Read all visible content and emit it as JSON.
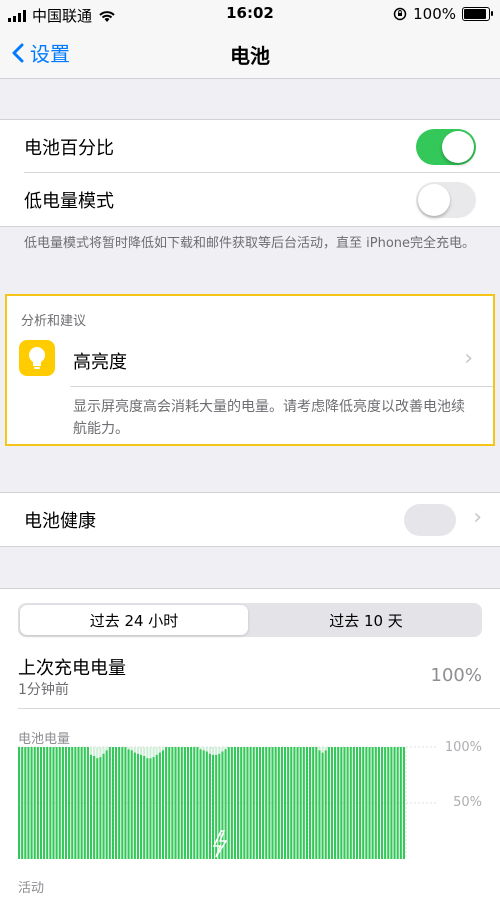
{
  "status_bar": {
    "carrier": "中国联通",
    "time": "16:02",
    "battery_pct": "100%",
    "battery_level": 1.0
  },
  "nav": {
    "back_label": "设置",
    "title": "电池"
  },
  "settings": {
    "battery_percentage": {
      "label": "电池百分比",
      "on": true
    },
    "low_power_mode": {
      "label": "低电量模式",
      "on": false
    },
    "low_power_footer": "低电量模式将暂时降低如下载和邮件获取等后台活动，直至 iPhone完全充电。"
  },
  "insights": {
    "header": "分析和建议",
    "item_title": "高亮度",
    "item_desc": "显示屏亮度高会消耗大量的电量。请考虑降低亮度以改善电池续航能力。",
    "icon": "lightbulb-icon"
  },
  "battery_health": {
    "label": "电池健康"
  },
  "usage": {
    "tabs": [
      "过去 24 小时",
      "过去 10 天"
    ],
    "selected_tab": 0,
    "last_charge_label": "上次充电电量",
    "last_charge_time": "1分钟前",
    "last_charge_value": "100%",
    "battery_level_label": "电池电量",
    "axis_labels": [
      "100%",
      "50%"
    ],
    "activity_label": "活动"
  },
  "colors": {
    "accent": "#007aff",
    "toggle_on": "#34c759",
    "chart": "#34c759",
    "highlight": "#f5c518"
  },
  "chart_data": {
    "type": "bar",
    "ylim": [
      0,
      100
    ],
    "values": [
      100,
      100,
      100,
      100,
      100,
      100,
      100,
      100,
      100,
      100,
      100,
      100,
      100,
      100,
      100,
      100,
      100,
      100,
      100,
      100,
      100,
      100,
      100,
      93,
      92,
      90,
      91,
      94,
      97,
      100,
      100,
      100,
      100,
      100,
      100,
      98,
      97,
      95,
      94,
      93,
      92,
      90,
      90,
      91,
      93,
      95,
      97,
      100,
      100,
      100,
      100,
      100,
      100,
      100,
      100,
      100,
      100,
      100,
      98,
      97,
      96,
      94,
      93,
      93,
      94,
      96,
      98,
      100,
      100,
      100,
      100,
      100,
      100,
      100,
      100,
      100,
      100,
      100,
      100,
      100,
      100,
      100,
      100,
      100,
      100,
      100,
      100,
      100,
      100,
      100,
      100,
      100,
      100,
      100,
      100,
      100,
      97,
      95,
      97,
      100,
      100,
      100,
      100,
      100,
      100,
      100,
      100,
      100,
      100,
      100,
      100,
      100,
      100,
      100,
      100,
      100,
      100,
      100,
      100,
      100,
      100,
      100,
      100,
      100
    ]
  }
}
